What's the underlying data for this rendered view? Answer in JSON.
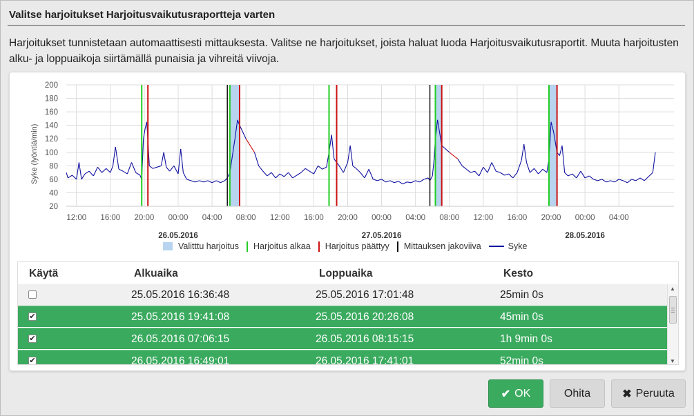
{
  "dialog": {
    "title": "Valitse harjoitukset Harjoitusvaikutusraportteja varten",
    "description": "Harjoitukset tunnistetaan automaattisesti mittauksesta. Valitse ne harjoitukset, joista haluat luoda Harjoitusvaikutusraportit. Muuta harjoitusten alku- ja loppuaikoja siirtämällä punaisia ja vihreitä viivoja."
  },
  "chart_data": {
    "type": "line",
    "ylabel": "Syke (lyöntiä/min)",
    "ylim": [
      20,
      200
    ],
    "yticks": [
      200,
      180,
      160,
      140,
      120,
      100,
      80,
      60,
      40,
      20
    ],
    "xlim_hours": [
      10.8,
      82.5
    ],
    "xticks": [
      {
        "h": 12,
        "label": "12:00"
      },
      {
        "h": 16,
        "label": "16:00"
      },
      {
        "h": 20,
        "label": "20:00"
      },
      {
        "h": 24,
        "label": "00:00"
      },
      {
        "h": 28,
        "label": "04:00"
      },
      {
        "h": 32,
        "label": "08:00"
      },
      {
        "h": 36,
        "label": "12:00"
      },
      {
        "h": 40,
        "label": "16:00"
      },
      {
        "h": 44,
        "label": "20:00"
      },
      {
        "h": 48,
        "label": "00:00"
      },
      {
        "h": 52,
        "label": "04:00"
      },
      {
        "h": 56,
        "label": "08:00"
      },
      {
        "h": 60,
        "label": "12:00"
      },
      {
        "h": 64,
        "label": "16:00"
      },
      {
        "h": 68,
        "label": "20:00"
      },
      {
        "h": 72,
        "label": "00:00"
      },
      {
        "h": 76,
        "label": "04:00"
      }
    ],
    "date_labels": [
      {
        "h": 24,
        "label": "26.05.2016"
      },
      {
        "h": 48,
        "label": "27.05.2016"
      },
      {
        "h": 72,
        "label": "28.05.2016"
      }
    ],
    "grid": true,
    "selected_workouts": [
      [
        30.1,
        31.25
      ],
      [
        54.35,
        55.1
      ],
      [
        67.75,
        68.7
      ]
    ],
    "workout_starts": [
      19.7,
      30.1,
      41.8,
      54.35,
      67.75
    ],
    "workout_ends": [
      20.43,
      31.25,
      42.7,
      55.1,
      68.7
    ],
    "division_lines": [
      29.8,
      53.7
    ],
    "series": [
      {
        "name": "Syke",
        "color": "#1010a0",
        "points": [
          [
            10.8,
            70
          ],
          [
            11,
            62
          ],
          [
            11.5,
            66
          ],
          [
            12,
            60
          ],
          [
            12.3,
            85
          ],
          [
            12.6,
            60
          ],
          [
            13,
            68
          ],
          [
            13.5,
            72
          ],
          [
            14,
            65
          ],
          [
            14.5,
            78
          ],
          [
            15,
            70
          ],
          [
            15.5,
            76
          ],
          [
            16,
            70
          ],
          [
            16.3,
            80
          ],
          [
            16.6,
            108
          ],
          [
            17,
            75
          ],
          [
            17.5,
            72
          ],
          [
            18,
            68
          ],
          [
            18.5,
            85
          ],
          [
            19,
            70
          ],
          [
            19.5,
            66
          ],
          [
            19.7,
            60
          ],
          [
            19.9,
            120
          ],
          [
            20.1,
            135
          ],
          [
            20.3,
            145
          ],
          [
            20.6,
            80
          ],
          [
            21,
            76
          ],
          [
            21.5,
            78
          ],
          [
            22,
            80
          ],
          [
            22.3,
            100
          ],
          [
            22.6,
            78
          ],
          [
            23,
            72
          ],
          [
            23.5,
            80
          ],
          [
            24,
            68
          ],
          [
            24.3,
            105
          ],
          [
            24.6,
            70
          ],
          [
            25,
            60
          ],
          [
            25.5,
            58
          ],
          [
            26,
            56
          ],
          [
            26.5,
            58
          ],
          [
            27,
            56
          ],
          [
            27.5,
            58
          ],
          [
            28,
            55
          ],
          [
            28.5,
            58
          ],
          [
            29,
            55
          ],
          [
            29.5,
            58
          ],
          [
            29.8,
            62
          ],
          [
            30.1,
            70
          ],
          [
            30.4,
            95
          ],
          [
            30.7,
            120
          ],
          [
            31,
            148
          ],
          [
            31.25,
            140
          ],
          [
            32,
            120
          ],
          [
            33,
            100
          ],
          [
            33.5,
            80
          ],
          [
            34,
            72
          ],
          [
            34.5,
            65
          ],
          [
            35,
            70
          ],
          [
            35.5,
            62
          ],
          [
            36,
            68
          ],
          [
            36.5,
            64
          ],
          [
            37,
            70
          ],
          [
            37.5,
            62
          ],
          [
            38,
            66
          ],
          [
            38.5,
            70
          ],
          [
            39,
            76
          ],
          [
            39.5,
            72
          ],
          [
            40,
            68
          ],
          [
            40.5,
            80
          ],
          [
            41,
            75
          ],
          [
            41.5,
            78
          ],
          [
            41.8,
            100
          ],
          [
            42.1,
            126
          ],
          [
            42.4,
            90
          ],
          [
            42.7,
            85
          ],
          [
            43,
            80
          ],
          [
            43.5,
            70
          ],
          [
            44,
            85
          ],
          [
            44.3,
            110
          ],
          [
            44.6,
            80
          ],
          [
            45,
            76
          ],
          [
            45.5,
            70
          ],
          [
            46,
            62
          ],
          [
            46.5,
            75
          ],
          [
            47,
            60
          ],
          [
            47.5,
            58
          ],
          [
            48,
            60
          ],
          [
            48.5,
            56
          ],
          [
            49,
            58
          ],
          [
            49.5,
            55
          ],
          [
            50,
            57
          ],
          [
            50.5,
            53
          ],
          [
            51,
            56
          ],
          [
            51.5,
            55
          ],
          [
            52,
            58
          ],
          [
            52.5,
            56
          ],
          [
            53,
            60
          ],
          [
            53.5,
            62
          ],
          [
            53.7,
            58
          ],
          [
            54,
            65
          ],
          [
            54.2,
            90
          ],
          [
            54.35,
            120
          ],
          [
            54.6,
            148
          ],
          [
            55.1,
            110
          ],
          [
            56,
            100
          ],
          [
            57,
            90
          ],
          [
            57.5,
            80
          ],
          [
            58,
            75
          ],
          [
            58.5,
            70
          ],
          [
            59,
            72
          ],
          [
            59.5,
            65
          ],
          [
            60,
            78
          ],
          [
            60.5,
            70
          ],
          [
            61,
            85
          ],
          [
            61.5,
            72
          ],
          [
            62,
            70
          ],
          [
            62.5,
            66
          ],
          [
            63,
            68
          ],
          [
            63.5,
            62
          ],
          [
            64,
            70
          ],
          [
            64.5,
            88
          ],
          [
            64.8,
            112
          ],
          [
            65.1,
            85
          ],
          [
            65.5,
            70
          ],
          [
            66,
            76
          ],
          [
            66.5,
            68
          ],
          [
            67,
            75
          ],
          [
            67.5,
            70
          ],
          [
            67.75,
            90
          ],
          [
            68,
            145
          ],
          [
            68.3,
            130
          ],
          [
            68.7,
            100
          ],
          [
            69,
            95
          ],
          [
            69.3,
            110
          ],
          [
            69.6,
            70
          ],
          [
            70,
            65
          ],
          [
            70.5,
            68
          ],
          [
            71,
            62
          ],
          [
            71.5,
            72
          ],
          [
            72,
            62
          ],
          [
            72.5,
            65
          ],
          [
            73,
            60
          ],
          [
            73.5,
            58
          ],
          [
            74,
            60
          ],
          [
            74.5,
            56
          ],
          [
            75,
            58
          ],
          [
            75.5,
            56
          ],
          [
            76,
            60
          ],
          [
            76.5,
            58
          ],
          [
            77,
            55
          ],
          [
            77.5,
            60
          ],
          [
            78,
            58
          ],
          [
            78.5,
            62
          ],
          [
            79,
            58
          ],
          [
            79.5,
            64
          ],
          [
            80,
            70
          ],
          [
            80.3,
            100
          ]
        ]
      }
    ]
  },
  "legend": {
    "selected": "Valitttu harjoitus",
    "start": "Harjoitus alkaa",
    "end": "Harjoitus päättyy",
    "division": "Mittauksen jakoviiva",
    "hr": "Syke",
    "colors": {
      "selected": "#b8d4ee",
      "start": "#22cc22",
      "end": "#cc1111",
      "division": "#111111",
      "hr": "#1010a0",
      "hr_gap": "#cc1111"
    }
  },
  "table": {
    "headers": {
      "use": "Käytä",
      "start": "Alkuaika",
      "end": "Loppuaika",
      "duration": "Kesto"
    },
    "rows": [
      {
        "start": "25.05.2016 16:36:48",
        "end": "25.05.2016 17:01:48",
        "duration": "25min 0s",
        "checked": false
      },
      {
        "start": "25.05.2016 19:41:08",
        "end": "25.05.2016 20:26:08",
        "duration": "45min 0s",
        "checked": true
      },
      {
        "start": "26.05.2016 07:06:15",
        "end": "26.05.2016 08:15:15",
        "duration": "1h 9min 0s",
        "checked": true
      },
      {
        "start": "26.05.2016 16:49:01",
        "end": "26.05.2016 17:41:01",
        "duration": "52min 0s",
        "checked": true
      }
    ]
  },
  "buttons": {
    "ok": "OK",
    "skip": "Ohita",
    "cancel": "Peruuta"
  }
}
